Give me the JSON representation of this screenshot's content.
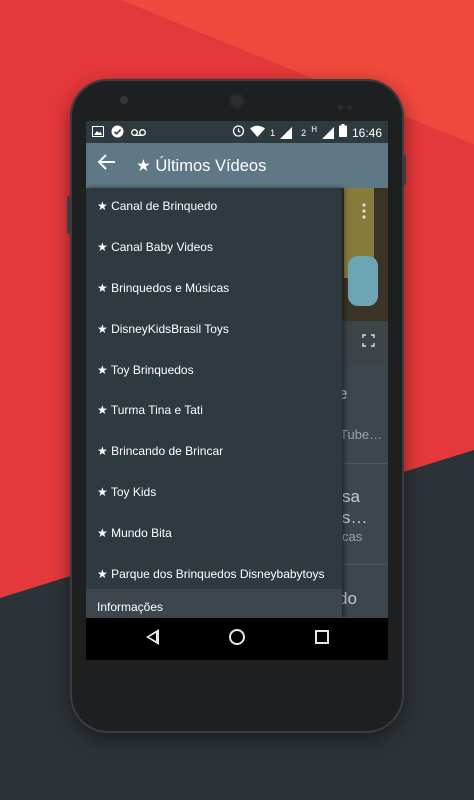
{
  "status_bar": {
    "time": "16:46",
    "sim1_label": "1",
    "sim2_label": "2",
    "network_label": "H",
    "icons": [
      "image-icon",
      "check-circle-icon",
      "voicemail-icon",
      "alarm-icon",
      "wifi-icon",
      "signal-icon",
      "battery-icon"
    ]
  },
  "toolbar": {
    "title": "★ Últimos Vídeos",
    "back_icon": "arrow-left-icon"
  },
  "drawer": {
    "items": [
      "★ Canal de Brinquedo",
      "★ Canal Baby Videos",
      "★ Brinquedos e Músicas",
      "★ DisneyKidsBrasil Toys",
      "★ Toy Brinquedos",
      "★ Turma Tina e Tati",
      "★ Brincando de Brincar",
      "★ Toy Kids",
      "★ Mundo Bita",
      "★ Parque dos Brinquedos Disneybabytoys"
    ],
    "section_label": "Informações"
  },
  "content_peek": {
    "line1": "e",
    "line2": "Tube…",
    "line3": "sa",
    "line4": "s…",
    "line5": "cas",
    "line6": "do"
  },
  "nav_bar": {
    "back_icon": "nav-back-icon",
    "home_icon": "nav-home-icon",
    "recent_icon": "nav-recent-icon"
  }
}
